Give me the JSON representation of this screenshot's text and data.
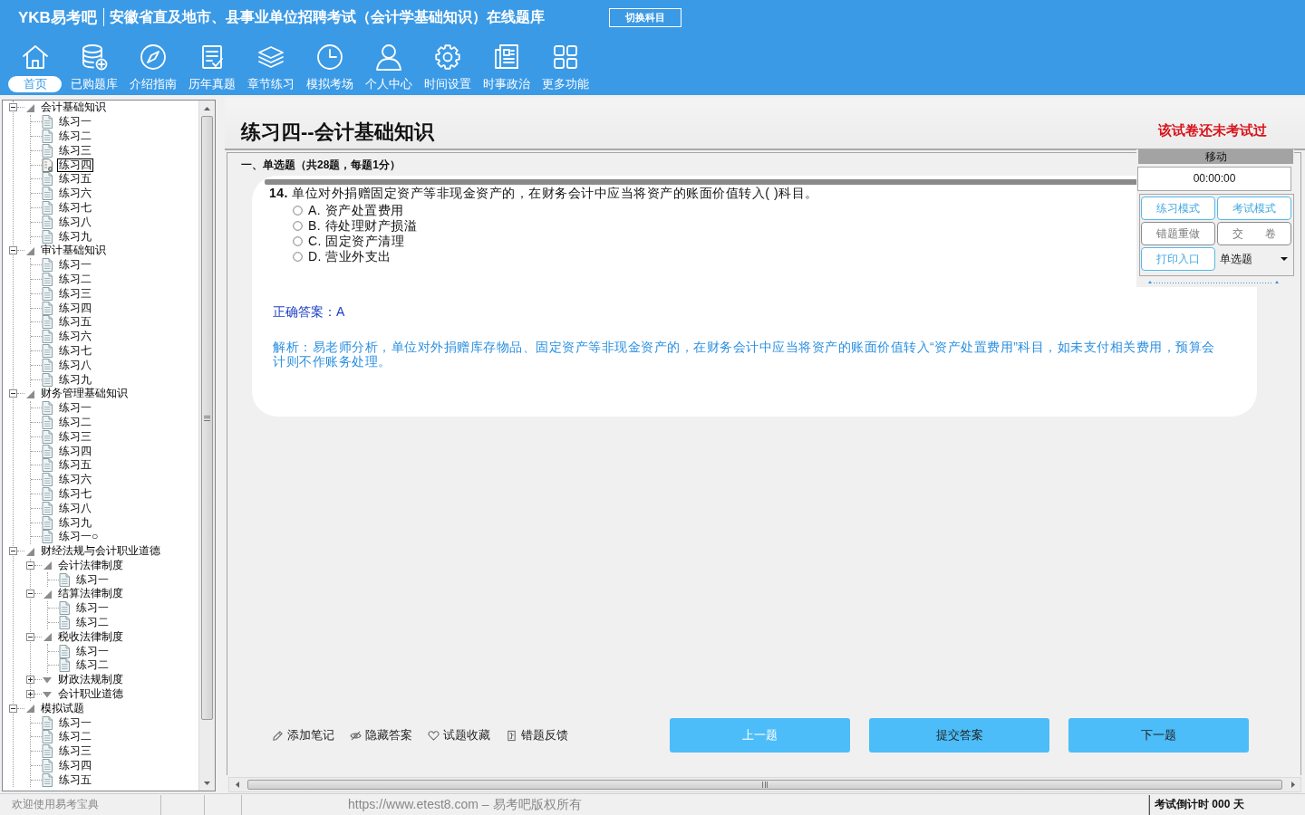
{
  "header": {
    "logo": "YKB易考吧",
    "title": "安徽省直及地市、县事业单位招聘考试（会计学基础知识）在线题库",
    "switch_button": "切换科目"
  },
  "nav": [
    {
      "label": "首页",
      "selected": true
    },
    {
      "label": "已购题库",
      "selected": false
    },
    {
      "label": "介绍指南",
      "selected": false
    },
    {
      "label": "历年真题",
      "selected": false
    },
    {
      "label": "章节练习",
      "selected": false
    },
    {
      "label": "模拟考场",
      "selected": false
    },
    {
      "label": "个人中心",
      "selected": false
    },
    {
      "label": "时间设置",
      "selected": false
    },
    {
      "label": "时事政治",
      "selected": false
    },
    {
      "label": "更多功能",
      "selected": false
    }
  ],
  "tree": [
    {
      "kind": "folder",
      "label": "会计基础知识",
      "expanded": true,
      "children": [
        {
          "kind": "exercise",
          "label": "练习一",
          "selected": false
        },
        {
          "kind": "exercise",
          "label": "练习二",
          "selected": false
        },
        {
          "kind": "exercise",
          "label": "练习三",
          "selected": false
        },
        {
          "kind": "exercise",
          "label": "练习四",
          "selected": true
        },
        {
          "kind": "exercise",
          "label": "练习五",
          "selected": false
        },
        {
          "kind": "exercise",
          "label": "练习六",
          "selected": false
        },
        {
          "kind": "exercise",
          "label": "练习七",
          "selected": false
        },
        {
          "kind": "exercise",
          "label": "练习八",
          "selected": false
        },
        {
          "kind": "exercise",
          "label": "练习九",
          "selected": false
        }
      ]
    },
    {
      "kind": "folder",
      "label": "审计基础知识",
      "expanded": true,
      "children": [
        {
          "kind": "exercise",
          "label": "练习一",
          "selected": false
        },
        {
          "kind": "exercise",
          "label": "练习二",
          "selected": false
        },
        {
          "kind": "exercise",
          "label": "练习三",
          "selected": false
        },
        {
          "kind": "exercise",
          "label": "练习四",
          "selected": false
        },
        {
          "kind": "exercise",
          "label": "练习五",
          "selected": false
        },
        {
          "kind": "exercise",
          "label": "练习六",
          "selected": false
        },
        {
          "kind": "exercise",
          "label": "练习七",
          "selected": false
        },
        {
          "kind": "exercise",
          "label": "练习八",
          "selected": false
        },
        {
          "kind": "exercise",
          "label": "练习九",
          "selected": false
        }
      ]
    },
    {
      "kind": "folder",
      "label": "财务管理基础知识",
      "expanded": true,
      "children": [
        {
          "kind": "exercise",
          "label": "练习一",
          "selected": false
        },
        {
          "kind": "exercise",
          "label": "练习二",
          "selected": false
        },
        {
          "kind": "exercise",
          "label": "练习三",
          "selected": false
        },
        {
          "kind": "exercise",
          "label": "练习四",
          "selected": false
        },
        {
          "kind": "exercise",
          "label": "练习五",
          "selected": false
        },
        {
          "kind": "exercise",
          "label": "练习六",
          "selected": false
        },
        {
          "kind": "exercise",
          "label": "练习七",
          "selected": false
        },
        {
          "kind": "exercise",
          "label": "练习八",
          "selected": false
        },
        {
          "kind": "exercise",
          "label": "练习九",
          "selected": false
        },
        {
          "kind": "exercise",
          "label": "练习一○",
          "selected": false
        }
      ]
    },
    {
      "kind": "folder",
      "label": "财经法规与会计职业道德",
      "expanded": true,
      "children": [
        {
          "kind": "folder",
          "label": "会计法律制度",
          "expanded": true,
          "children": [
            {
              "kind": "exercise",
              "label": "练习一",
              "selected": false
            }
          ]
        },
        {
          "kind": "folder",
          "label": "结算法律制度",
          "expanded": true,
          "children": [
            {
              "kind": "exercise",
              "label": "练习一",
              "selected": false
            },
            {
              "kind": "exercise",
              "label": "练习二",
              "selected": false
            }
          ]
        },
        {
          "kind": "folder",
          "label": "税收法律制度",
          "expanded": true,
          "children": [
            {
              "kind": "exercise",
              "label": "练习一",
              "selected": false
            },
            {
              "kind": "exercise",
              "label": "练习二",
              "selected": false
            }
          ]
        },
        {
          "kind": "folder",
          "label": "财政法规制度",
          "expanded": false
        },
        {
          "kind": "folder",
          "label": "会计职业道德",
          "expanded": false
        }
      ]
    },
    {
      "kind": "folder",
      "label": "模拟试题",
      "expanded": true,
      "children": [
        {
          "kind": "exercise",
          "label": "练习一",
          "selected": false
        },
        {
          "kind": "exercise",
          "label": "练习二",
          "selected": false
        },
        {
          "kind": "exercise",
          "label": "练习三",
          "selected": false
        },
        {
          "kind": "exercise",
          "label": "练习四",
          "selected": false
        },
        {
          "kind": "exercise",
          "label": "练习五",
          "selected": false
        }
      ]
    }
  ],
  "exercise": {
    "title": "练习四--会计基础知识",
    "status": "该试卷还未考试过",
    "section": "一、单选题（共28题，每题1分）"
  },
  "question": {
    "text": "**14.** 单位对外捐赠固定资产等非现金资产的，在财务会计中应当将资产的账面价值转入( )科目。",
    "options": [
      {
        "label": "A. 资产处置费用",
        "selected": false
      },
      {
        "label": "B. 待处理财产损溢",
        "selected": false
      },
      {
        "label": "C. 固定资产清理",
        "selected": false
      },
      {
        "label": "D. 营业外支出",
        "selected": false
      }
    ],
    "answer": "正确答案：A",
    "analysis": "解析：易老师分析，单位对外捐赠库存物品、固定资产等非现金资产的，在财务会计中应当将资产的账面价值转入“资产处置费用”科目，如未支付相关费用，预算会计则不作账务处理。"
  },
  "side_panel": {
    "handle": "移动",
    "timer": "00:00:00",
    "buttons": [
      {
        "label": "练习模式",
        "disabled": false
      },
      {
        "label": "考试模式",
        "disabled": false
      },
      {
        "label": "错题重做",
        "disabled": true
      },
      {
        "label": "交　　卷",
        "disabled": true
      },
      {
        "label": "打印入口",
        "disabled": false
      }
    ],
    "type_select": "单选题"
  },
  "tools": [
    "添加笔记",
    "隐藏答案",
    "试题收藏",
    "错题反馈"
  ],
  "nav_buttons": [
    {
      "label": "上一题",
      "disabled": true
    },
    {
      "label": "提交答案",
      "disabled": false
    },
    {
      "label": "下一题",
      "disabled": false
    }
  ],
  "status_bar": {
    "welcome": "欢迎使用易考宝典",
    "copyright": "https://www.etest8.com – 易考吧版权所有",
    "countdown": "考试倒计时 000 天"
  }
}
